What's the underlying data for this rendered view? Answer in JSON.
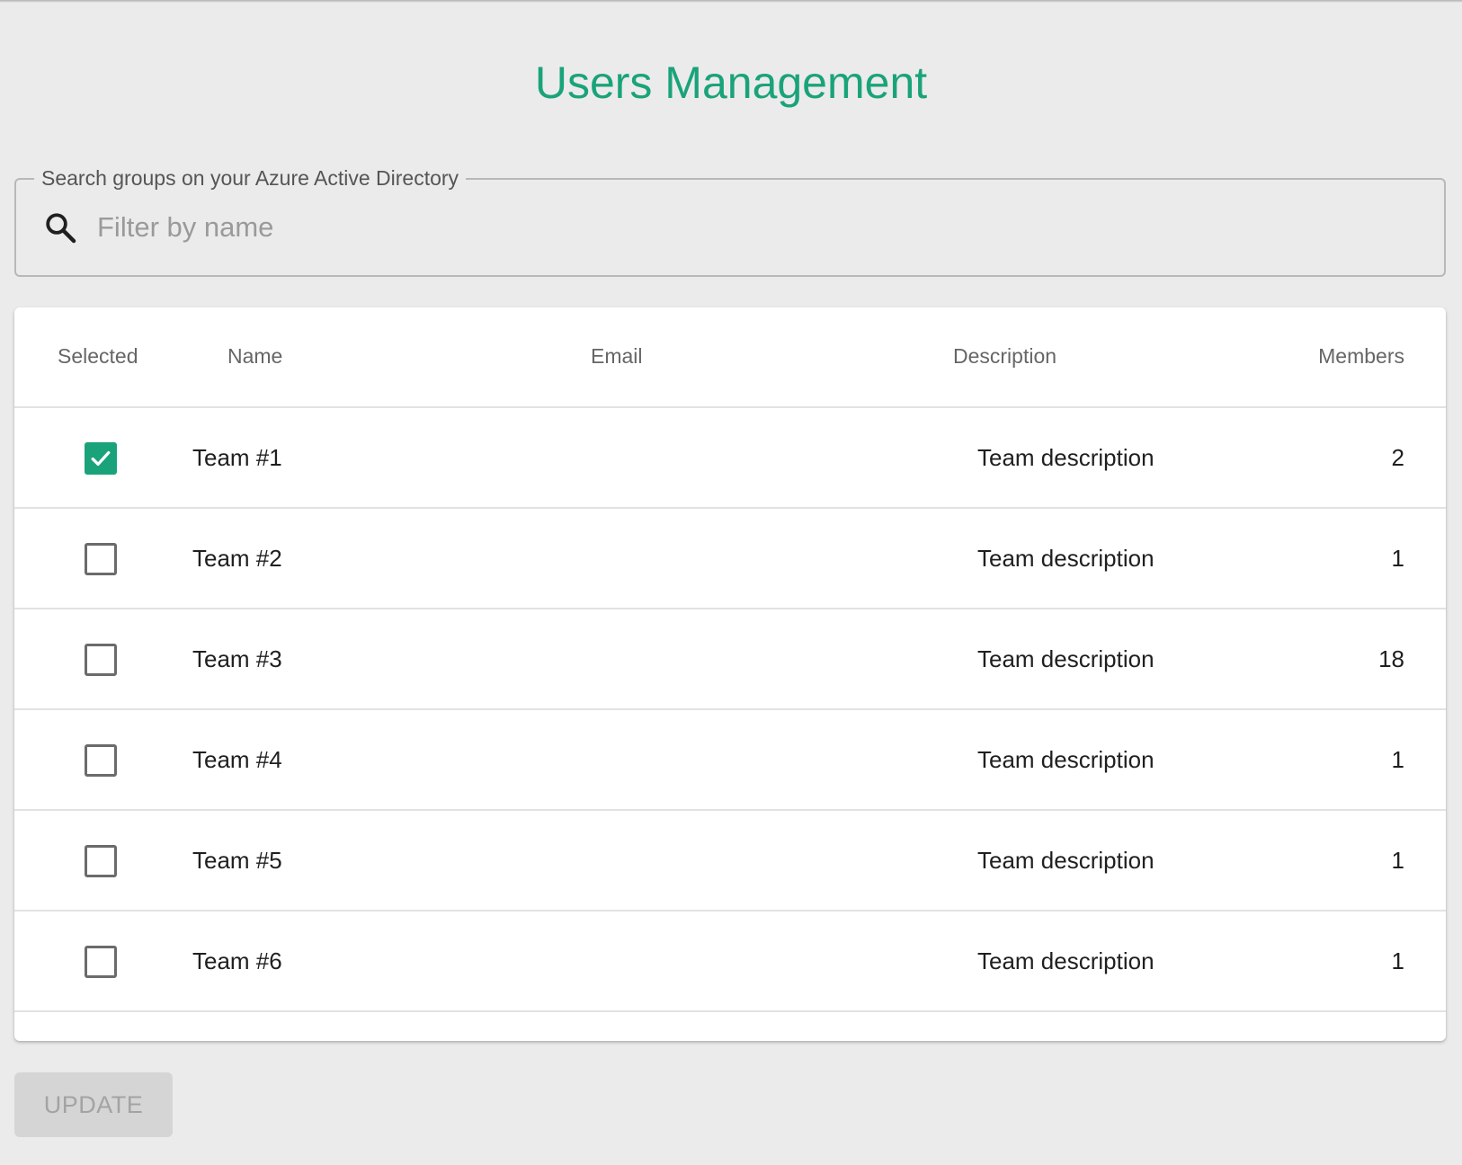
{
  "page": {
    "title": "Users Management",
    "accent_color": "#1aa37a"
  },
  "search": {
    "legend": "Search groups on your Azure Active Directory",
    "placeholder": "Filter by name",
    "value": "",
    "icon": "search-icon"
  },
  "table": {
    "columns": {
      "selected": "Selected",
      "name": "Name",
      "email": "Email",
      "description": "Description",
      "members": "Members"
    },
    "rows": [
      {
        "selected": true,
        "name": "Team #1",
        "email": "",
        "description": "Team description",
        "members": "2"
      },
      {
        "selected": false,
        "name": "Team #2",
        "email": "",
        "description": "Team description",
        "members": "1"
      },
      {
        "selected": false,
        "name": "Team #3",
        "email": "",
        "description": "Team description",
        "members": "18"
      },
      {
        "selected": false,
        "name": "Team #4",
        "email": "",
        "description": "Team description",
        "members": "1"
      },
      {
        "selected": false,
        "name": "Team #5",
        "email": "",
        "description": "Team description",
        "members": "1"
      },
      {
        "selected": false,
        "name": "Team #6",
        "email": "",
        "description": "Team description",
        "members": "1"
      }
    ]
  },
  "actions": {
    "update_label": "UPDATE",
    "update_disabled": true
  }
}
